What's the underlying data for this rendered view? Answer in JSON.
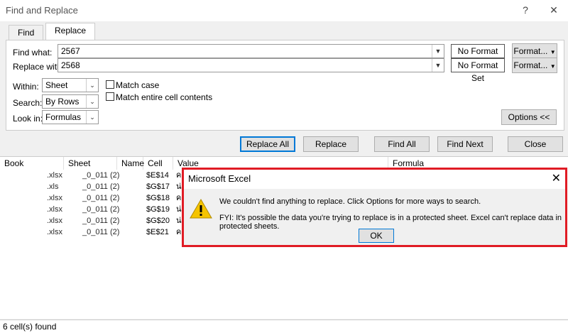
{
  "window": {
    "title": "Find and Replace",
    "help": "?",
    "close": "✕"
  },
  "tabs": [
    {
      "label": "Find"
    },
    {
      "label": "Replace"
    }
  ],
  "form": {
    "find_label": "Find what:",
    "find_value": "2567",
    "replace_label": "Replace with:",
    "replace_value": "2568",
    "no_format_1": "No Format Set",
    "no_format_2": "No Format Set",
    "format_btn_1": "Format...",
    "format_btn_2": "Format...",
    "within_label": "Within:",
    "within_value": "Sheet",
    "search_label": "Search:",
    "search_value": "By Rows",
    "lookin_label": "Look in:",
    "lookin_value": "Formulas",
    "match_case": "Match case",
    "match_entire": "Match entire cell contents",
    "options_btn": "Options <<"
  },
  "actions": {
    "replace_all": "Replace All",
    "replace": "Replace",
    "find_all": "Find All",
    "find_next": "Find Next",
    "close": "Close"
  },
  "results": {
    "headers": [
      "Book",
      "Sheet",
      "Name",
      "Cell",
      "Value",
      "Formula"
    ],
    "rows": [
      {
        "book": ".xlsx",
        "sheet": "_0_011 (2)",
        "cell": "$E$14",
        "value": "ค"
      },
      {
        "book": ".xls",
        "sheet": "_0_011 (2)",
        "cell": "$G$17",
        "value": "น่"
      },
      {
        "book": ".xlsx",
        "sheet": "_0_011 (2)",
        "cell": "$G$18",
        "value": "ค"
      },
      {
        "book": ".xlsx",
        "sheet": "_0_011 (2)",
        "cell": "$G$19",
        "value": "น่"
      },
      {
        "book": ".xlsx",
        "sheet": "_0_011 (2)",
        "cell": "$G$20",
        "value": "น่"
      },
      {
        "book": ".xlsx",
        "sheet": "_0_011 (2)",
        "cell": "$E$21",
        "value": "ค"
      }
    ],
    "status": "6 cell(s) found"
  },
  "message": {
    "title": "Microsoft Excel",
    "line1": "We couldn't find anything to replace. Click Options for more ways to search.",
    "line2": "FYI: It's possible the data you're trying to replace is in a protected sheet. Excel can't replace data in protected sheets.",
    "ok": "OK",
    "highlight_color": "#e01b24"
  }
}
